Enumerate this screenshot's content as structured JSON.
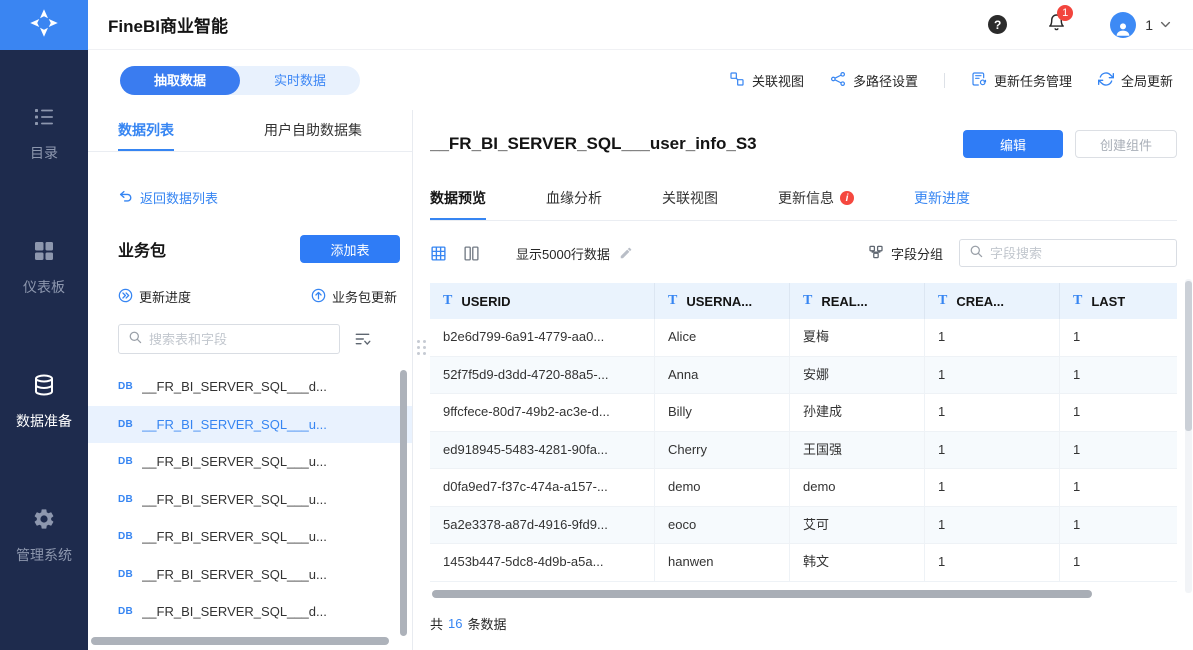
{
  "icons": {
    "text_type": "T",
    "db_label": "DB",
    "help_glyph": "?",
    "info_glyph": "i"
  },
  "header": {
    "app_title": "FineBI商业智能",
    "notification_badge": "1",
    "user_label": "1"
  },
  "sidebar": {
    "items": [
      {
        "label": "目录"
      },
      {
        "label": "仪表板"
      },
      {
        "label": "数据准备"
      },
      {
        "label": "管理系统"
      }
    ]
  },
  "subbar": {
    "extract_mode": "抽取数据",
    "realtime_mode": "实时数据",
    "link_view": "关联视图",
    "multipath_settings": "多路径设置",
    "update_task_mgmt": "更新任务管理",
    "global_update": "全局更新"
  },
  "left_panel": {
    "tab_data_list": "数据列表",
    "tab_self_service": "用户自助数据集",
    "back_link": "返回数据列表",
    "section_title": "业务包",
    "add_table_button": "添加表",
    "update_progress_link": "更新进度",
    "package_update_link": "业务包更新",
    "search_placeholder": "搜索表和字段",
    "tables": [
      {
        "name": "__FR_BI_SERVER_SQL___d..."
      },
      {
        "name": "__FR_BI_SERVER_SQL___u..."
      },
      {
        "name": "__FR_BI_SERVER_SQL___u..."
      },
      {
        "name": "__FR_BI_SERVER_SQL___u..."
      },
      {
        "name": "__FR_BI_SERVER_SQL___u..."
      },
      {
        "name": "__FR_BI_SERVER_SQL___u..."
      },
      {
        "name": "__FR_BI_SERVER_SQL___d..."
      }
    ]
  },
  "main": {
    "title": "__FR_BI_SERVER_SQL___user_info_S3",
    "edit_button": "编辑",
    "create_component_button": "创建组件",
    "tabs": {
      "data_preview": "数据预览",
      "lineage_analysis": "血缘分析",
      "link_view": "关联视图",
      "update_info": "更新信息",
      "update_progress": "更新进度"
    },
    "row_limit_label": "显示5000行数据",
    "field_group_label": "字段分组",
    "field_search_placeholder": "字段搜索",
    "table": {
      "columns": [
        "USERID",
        "USERNA...",
        "REAL...",
        "CREA...",
        "LAST"
      ],
      "rows": [
        [
          "b2e6d799-6a91-4779-aa0...",
          "Alice",
          "夏梅",
          "1",
          "1"
        ],
        [
          "52f7f5d9-d3dd-4720-88a5-...",
          "Anna",
          "安娜",
          "1",
          "1"
        ],
        [
          "9ffcfece-80d7-49b2-ac3e-d...",
          "Billy",
          "孙建成",
          "1",
          "1"
        ],
        [
          "ed918945-5483-4281-90fa...",
          "Cherry",
          "王国强",
          "1",
          "1"
        ],
        [
          "d0fa9ed7-f37c-474a-a157-...",
          "demo",
          "demo",
          "1",
          "1"
        ],
        [
          "5a2e3378-a87d-4916-9fd9...",
          "eoco",
          "艾可",
          "1",
          "1"
        ],
        [
          "1453b447-5dc8-4d9b-a5a...",
          "hanwen",
          "韩文",
          "1",
          "1"
        ]
      ]
    },
    "footer": {
      "total_prefix": "共",
      "total_count": "16",
      "total_suffix": "条数据"
    }
  },
  "colors": {
    "accent_blue": "#3685F2",
    "sidebar_bg": "#1E2B4D",
    "logo_bg": "#3A85F2",
    "table_header_bg": "#EAF3FD",
    "badge_red": "#F2453D"
  }
}
